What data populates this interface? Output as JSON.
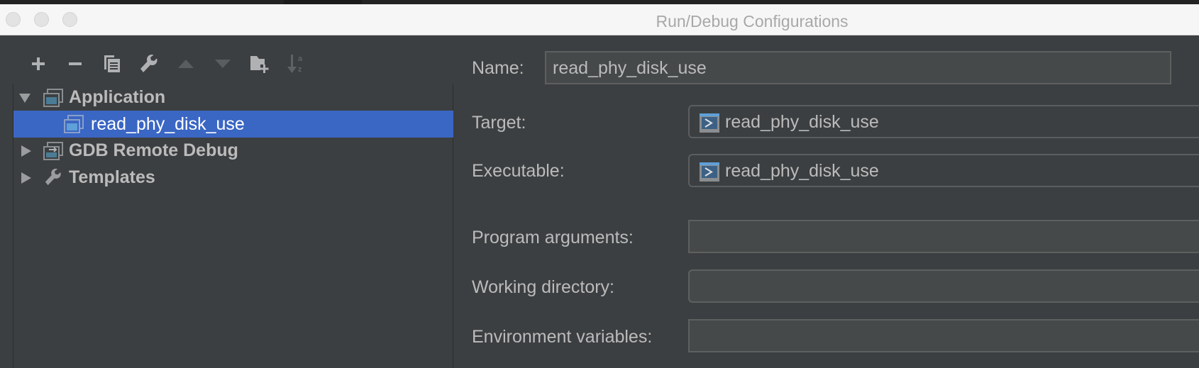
{
  "window": {
    "title": "Run/Debug Configurations"
  },
  "toolbar": {
    "buttons": [
      {
        "name": "add",
        "icon": "plus-icon"
      },
      {
        "name": "remove",
        "icon": "minus-icon"
      },
      {
        "name": "copy",
        "icon": "copy-icon"
      },
      {
        "name": "edit-defaults",
        "icon": "wrench-icon"
      },
      {
        "name": "move-up",
        "icon": "arrow-up-icon"
      },
      {
        "name": "move-down",
        "icon": "arrow-down-icon"
      },
      {
        "name": "new-folder",
        "icon": "folder-add-icon"
      },
      {
        "name": "sort-alphabetically",
        "icon": "sort-az-icon"
      }
    ],
    "sort_letters": "a z"
  },
  "tree": {
    "items": [
      {
        "label": "Application",
        "expanded": true,
        "icon": "application-icon",
        "level": 0
      },
      {
        "label": "read_phy_disk_use",
        "selected": true,
        "icon": "application-icon",
        "level": 1
      },
      {
        "label": "GDB Remote Debug",
        "expanded": false,
        "icon": "remote-debug-icon",
        "level": 0
      },
      {
        "label": "Templates",
        "expanded": false,
        "icon": "wrench-icon",
        "level": 0
      }
    ]
  },
  "form": {
    "name_label": "Name:",
    "name_value": "read_phy_disk_use",
    "target_label": "Target:",
    "target_value": "read_phy_disk_use",
    "executable_label": "Executable:",
    "executable_value": "read_phy_disk_use",
    "program_arguments_label": "Program arguments:",
    "program_arguments_value": "",
    "working_directory_label": "Working directory:",
    "working_directory_value": "",
    "environment_variables_label": "Environment variables:",
    "environment_variables_value": ""
  },
  "colors": {
    "selection": "#3a66c4",
    "background": "#3c3f41",
    "titlebar": "#f6f6f6",
    "text": "#bbbbbb"
  }
}
